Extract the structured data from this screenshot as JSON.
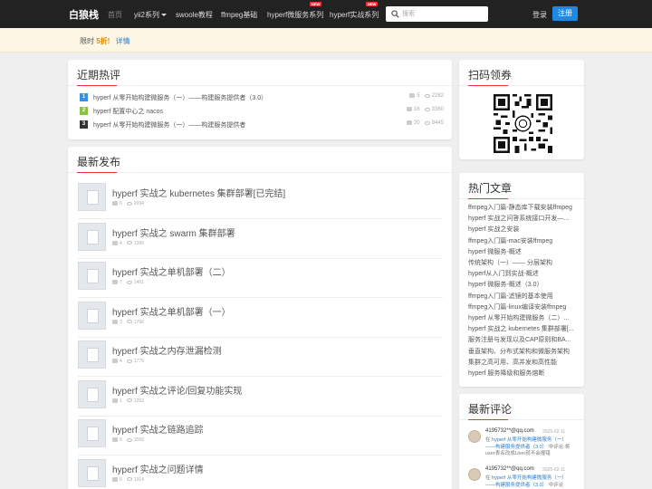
{
  "nav": {
    "brand": "白狼栈",
    "items": [
      "首页",
      "yii2系列",
      "swoole教程",
      "ffmpeg基础",
      "hyperf微服务系列",
      "hyperf实战系列"
    ],
    "new_badge": "NEW",
    "search_placeholder": "搜索",
    "login": "登录",
    "register": "注册"
  },
  "promo": {
    "prefix": "限时",
    "highlight": "5折!",
    "link": "详情"
  },
  "hot": {
    "title": "近期热评",
    "rows": [
      {
        "num": "1",
        "title": "hyperf 从零开始构建微服务（一）——构建服务提供者（3.0）",
        "comments": "5",
        "views": "2282"
      },
      {
        "num": "2",
        "title": "hyperf 配置中心之 nacos",
        "comments": "16",
        "views": "3360"
      },
      {
        "num": "3",
        "title": "hyperf 从零开始构建微服务（一）——构建服务提供者",
        "comments": "20",
        "views": "8445"
      }
    ]
  },
  "latest": {
    "title": "最新发布",
    "posts": [
      {
        "title": "hyperf 实战之 kubernetes 集群部署[已完结]",
        "comments": "6",
        "views": "2094"
      },
      {
        "title": "hyperf 实战之 swarm 集群部署",
        "comments": "4",
        "views": "1389"
      },
      {
        "title": "hyperf 实战之单机部署（二）",
        "comments": "7",
        "views": "1461"
      },
      {
        "title": "hyperf 实战之单机部署（一）",
        "comments": "3",
        "views": "1766"
      },
      {
        "title": "hyperf 实战之内存泄漏检测",
        "comments": "4",
        "views": "1779"
      },
      {
        "title": "hyperf 实战之评论/回复功能实现",
        "comments": "1",
        "views": "1252"
      },
      {
        "title": "hyperf 实战之链路追踪",
        "comments": "9",
        "views": "1569"
      },
      {
        "title": "hyperf 实战之问题详情",
        "comments": "5",
        "views": "1314"
      }
    ]
  },
  "qr": {
    "title": "扫码领券"
  },
  "articles": {
    "title": "热门文章",
    "items": [
      "ffmpeg入门篇-静态库下载安装ffmpeg",
      "hyperf 实战之问答系统接口开发—...",
      "hyperf 实战之安装",
      "ffmpeg入门篇-mac安装ffmpeg",
      "hyperf 微服务-概述",
      "传统架构（一）—— 分层架构",
      "hyperf从入门到实战-概述",
      "hyperf 微服务-概述（3.0）",
      "ffmpeg入门篇-滤镜的基本使用",
      "ffmpeg入门篇-linux编译安装ffmpeg",
      "hyperf 从零开始构建微服务（二）...",
      "hyperf 实战之 kubernetes 集群部署[...",
      "服务注册与发现以及CAP原则和BA...",
      "垂直架构、分布式架构和微服务架构",
      "集群之高可用、高并发和高性能",
      "hyperf 服务降级和服务熔断"
    ]
  },
  "comments": {
    "title": "最新评论",
    "items": [
      {
        "user": "4195732**@qq.com",
        "date": "2025-02-11",
        "prefix": "在",
        "link": "hyperf 从零开始构建微服务（一）——构建服务提供者（3.0）",
        "suffix": "中评论",
        "text": "将user表名改成User就不会报错"
      },
      {
        "user": "4195732**@qq.com",
        "date": "2025-02-11",
        "prefix": "在",
        "link": "hyperf 从零开始构建微服务（一）——构建服务提供者（3.0）",
        "suffix": "中评论",
        "text": ""
      }
    ]
  },
  "colors": {
    "accent": "#1e88e5",
    "rank1": "#3a8ee6",
    "rank2": "#8bc34a",
    "rank3": "#333333",
    "title_line": "#e33333"
  }
}
